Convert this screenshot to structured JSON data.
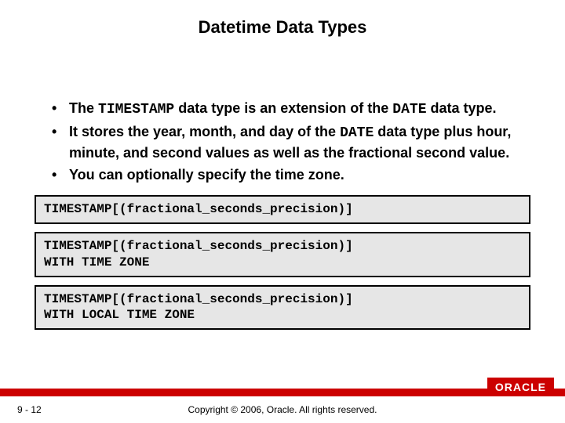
{
  "title": "Datetime Data Types",
  "bullets": [
    {
      "pre": "The ",
      "code1": "TIMESTAMP",
      "mid1": " data type is an extension of the ",
      "code2": "DATE",
      "post": " data type."
    },
    {
      "pre": "It stores the year, month, and day of the ",
      "code1": "DATE",
      "mid1": " data type plus hour, minute, and second values as well as the fractional second value.",
      "code2": "",
      "post": ""
    },
    {
      "pre": "You can optionally specify the time zone.",
      "code1": "",
      "mid1": "",
      "code2": "",
      "post": ""
    }
  ],
  "codeboxes": [
    "TIMESTAMP[(fractional_seconds_precision)]",
    "TIMESTAMP[(fractional_seconds_precision)]\nWITH TIME ZONE",
    "TIMESTAMP[(fractional_seconds_precision)]\nWITH LOCAL TIME ZONE"
  ],
  "footer": {
    "page": "9 - 12",
    "copyright": "Copyright © 2006, Oracle. All rights reserved.",
    "logo": "ORACLE"
  }
}
